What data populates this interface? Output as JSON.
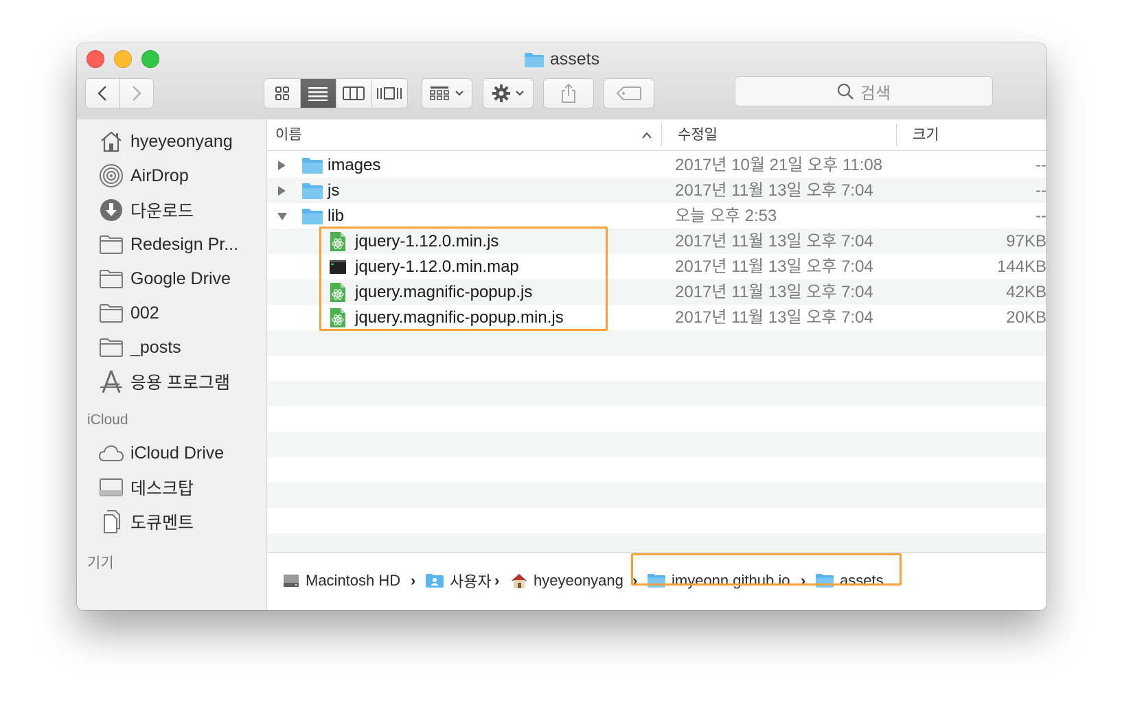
{
  "window": {
    "title": "assets"
  },
  "toolbar": {
    "back_icon": "chevron-left-icon",
    "forward_icon": "chevron-right-icon",
    "view_icons": [
      "icon-view-icon",
      "list-view-icon",
      "column-view-icon",
      "cover-flow-icon"
    ],
    "active_view": "list-view-icon",
    "search_placeholder": "검색"
  },
  "sidebar": {
    "favorites": [
      {
        "label": "hyeyeonyang",
        "icon": "home-icon"
      },
      {
        "label": "AirDrop",
        "icon": "airdrop-icon"
      },
      {
        "label": "다운로드",
        "icon": "download-icon"
      },
      {
        "label": "Redesign Pr...",
        "icon": "folder-icon"
      },
      {
        "label": "Google Drive",
        "icon": "folder-icon"
      },
      {
        "label": "002",
        "icon": "folder-icon"
      },
      {
        "label": "_posts",
        "icon": "folder-icon"
      },
      {
        "label": "응용 프로그램",
        "icon": "applications-icon"
      }
    ],
    "icloud_header": "iCloud",
    "icloud": [
      {
        "label": "iCloud Drive",
        "icon": "cloud-icon"
      },
      {
        "label": "데스크탑",
        "icon": "desktop-icon"
      },
      {
        "label": "도큐멘트",
        "icon": "document-icon"
      }
    ],
    "devices_header": "기기"
  },
  "columns": {
    "name": "이름",
    "modified": "수정일",
    "size": "크기"
  },
  "rows": [
    {
      "name": "images",
      "date": "2017년 10월 21일 오후 11:08",
      "size": "--",
      "kind": "folder",
      "expanded": false
    },
    {
      "name": "js",
      "date": "2017년 11월 13일 오후 7:04",
      "size": "--",
      "kind": "folder",
      "expanded": false
    },
    {
      "name": "lib",
      "date": "오늘 오후 2:53",
      "size": "--",
      "kind": "folder",
      "expanded": true
    },
    {
      "name": "jquery-1.12.0.min.js",
      "date": "2017년 11월 13일 오후 7:04",
      "size": "97KB",
      "kind": "js"
    },
    {
      "name": "jquery-1.12.0.min.map",
      "date": "2017년 11월 13일 오후 7:04",
      "size": "144KB",
      "kind": "map"
    },
    {
      "name": "jquery.magnific-popup.js",
      "date": "2017년 11월 13일 오후 7:04",
      "size": "42KB",
      "kind": "js"
    },
    {
      "name": "jquery.magnific-popup.min.js",
      "date": "2017년 11월 13일 오후 7:04",
      "size": "20KB",
      "kind": "js"
    }
  ],
  "pathbar": {
    "crumbs": [
      {
        "label": "Macintosh HD",
        "icon": "hard-drive-icon"
      },
      {
        "label": "사용자",
        "icon": "users-folder-icon"
      },
      {
        "label": "hyeyeonyang",
        "icon": "home-icon"
      },
      {
        "label": "imyeonn.github.io",
        "icon": "folder-icon"
      },
      {
        "label": "assets",
        "icon": "folder-icon"
      }
    ]
  },
  "colors": {
    "highlight": "#f5a13a",
    "folder": "#5ab6ec",
    "js_file": "#4caf50"
  }
}
